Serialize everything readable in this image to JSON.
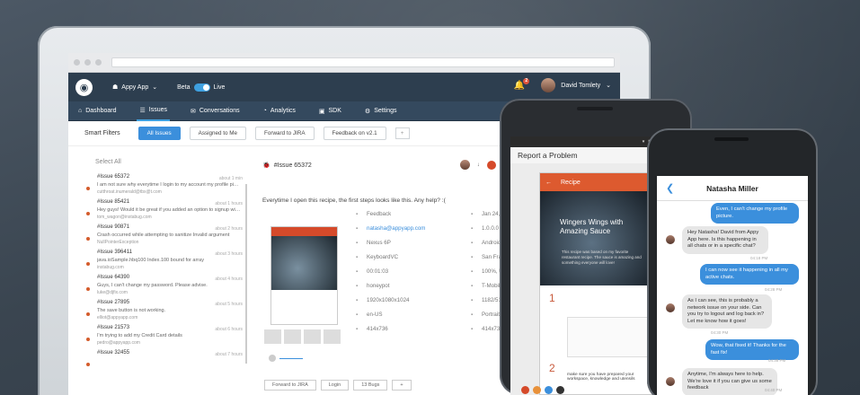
{
  "topbar": {
    "app_name": "Appy App",
    "beta_label": "Beta",
    "live_label": "Live",
    "notif_count": "2",
    "user_name": "David Tomlety"
  },
  "nav": {
    "items": [
      {
        "label": "Dashboard",
        "icon": "home-icon"
      },
      {
        "label": "Issues",
        "icon": "issues-icon"
      },
      {
        "label": "Conversations",
        "icon": "chat-icon"
      },
      {
        "label": "Analytics",
        "icon": "pie-icon"
      },
      {
        "label": "SDK",
        "icon": "box-icon"
      },
      {
        "label": "Settings",
        "icon": "gear-icon"
      }
    ]
  },
  "filters": {
    "label": "Smart Filters",
    "chips": [
      "All Issues",
      "Assigned to Me",
      "Forward to JIRA",
      "Feedback on v2.1"
    ]
  },
  "list": {
    "select_all": "Select All",
    "rows": [
      {
        "title": "#Issue 65372",
        "time": "about 1 min",
        "snippet": "I am not sure why everytime I login to my account my profile pic is reset",
        "meta": "cutthroat.inumerald@tbx@t.com"
      },
      {
        "title": "#Issue 85421",
        "time": "about 1 hours",
        "snippet": "Hey guys! Would it be great if you added an option to signup with Faceb...",
        "meta": "tom_wagon@instabug.com"
      },
      {
        "title": "#Issue 90871",
        "time": "about 2 hours",
        "snippet": "Crash occurred while attempting to sanitize Invalid argument",
        "meta": "NullPointerException"
      },
      {
        "title": "#Issue 396411",
        "time": "about 3 hours",
        "snippet": "java.ioSample.hbq100 Index.100 bound for array",
        "meta": "instabug.com"
      },
      {
        "title": "#Issue 64390",
        "time": "about 4 hours",
        "snippet": "Guys, I can't change my password. Please advise.",
        "meta": "luke@djfix.com"
      },
      {
        "title": "#Issue 27895",
        "time": "about 5 hours",
        "snippet": "The save button is not working.",
        "meta": "elliot@appyapp.com"
      },
      {
        "title": "#Issue 21573",
        "time": "about 6 hours",
        "snippet": "I'm trying to add my Credit Card details",
        "meta": "pedro@appyapp.com"
      },
      {
        "title": "#Issue 32455",
        "time": "about 7 hours",
        "snippet": "",
        "meta": ""
      }
    ]
  },
  "detail": {
    "title": "#Issue 65372",
    "body": "Everytime I open this recipe, the first steps looks like this. Any help? :(",
    "info_left": [
      {
        "icon": "feedback-icon",
        "text": "Feedback"
      },
      {
        "icon": "mail-icon",
        "text": "natasha@appyapp.com",
        "link": true
      },
      {
        "icon": "phone-icon",
        "text": "Nexus 6P"
      },
      {
        "icon": "keyboard-icon",
        "text": "KeyboardVC"
      },
      {
        "icon": "clock-icon",
        "text": "00:01:03"
      },
      {
        "icon": "wifi-icon",
        "text": "honeypot"
      },
      {
        "icon": "screen-icon",
        "text": "1920x1080x1024"
      },
      {
        "icon": "globe-icon",
        "text": "en-US"
      },
      {
        "icon": "size-icon",
        "text": "414x736"
      }
    ],
    "info_right": [
      {
        "icon": "calendar-icon",
        "text": "Jan 24, 2016"
      },
      {
        "icon": "tag-icon",
        "text": "1.0.0.0"
      },
      {
        "icon": "android-icon",
        "text": "Android 6"
      },
      {
        "icon": "location-icon",
        "text": "San Francisco"
      },
      {
        "icon": "battery-icon",
        "text": "100%, Unplugged"
      },
      {
        "icon": "signal-icon",
        "text": "T-Mobile"
      },
      {
        "icon": "memory-icon",
        "text": "1182/5120"
      },
      {
        "icon": "rotate-icon",
        "text": "Portrait"
      },
      {
        "icon": "expand-icon",
        "text": "414x736"
      }
    ],
    "tags": [
      "Forward to JIRA",
      "Login",
      "13 Bugs"
    ]
  },
  "android": {
    "title": "Report a Problem",
    "app_bar": "Recipe",
    "recipe_title": "Wingers Wings with Amazing Sauce",
    "recipe_sub": "This recipe was based on my favorite restaurant recipe. The sauce is amazing and something everyone will love!",
    "step1": "1",
    "step2": "2",
    "step_text": "make sure you have prepared your workspace, knowledge and utensils"
  },
  "iphone": {
    "contact": "Natasha Miller",
    "messages": [
      {
        "dir": "out",
        "text": "Even, I can't change my profile picture."
      },
      {
        "dir": "in",
        "text": "Hey Natasha! David from Appy App here. Is this happening in all chats or in a specific chat?"
      },
      {
        "dir": "out",
        "text": "I can now see it happening in all my active chats."
      },
      {
        "dir": "in",
        "text": "As I can see, this is probably a network issue on your side. Can you try to logout and log back in? Let me know how it goes!"
      },
      {
        "dir": "out",
        "text": "Wow, that fixed it! Thanks for the fast fix!"
      },
      {
        "dir": "in",
        "text": "Anytime, I'm always here to help. We're love it if you can give us some feedback"
      }
    ],
    "times": [
      "04:18 PM",
      "04:28 PM",
      "04:30 PM",
      "04:38 PM",
      "04:40 PM"
    ]
  },
  "colors": {
    "accent": "#3b8fdc",
    "brand_dark": "#2d3e4f",
    "issue_red": "#d54a2a"
  }
}
